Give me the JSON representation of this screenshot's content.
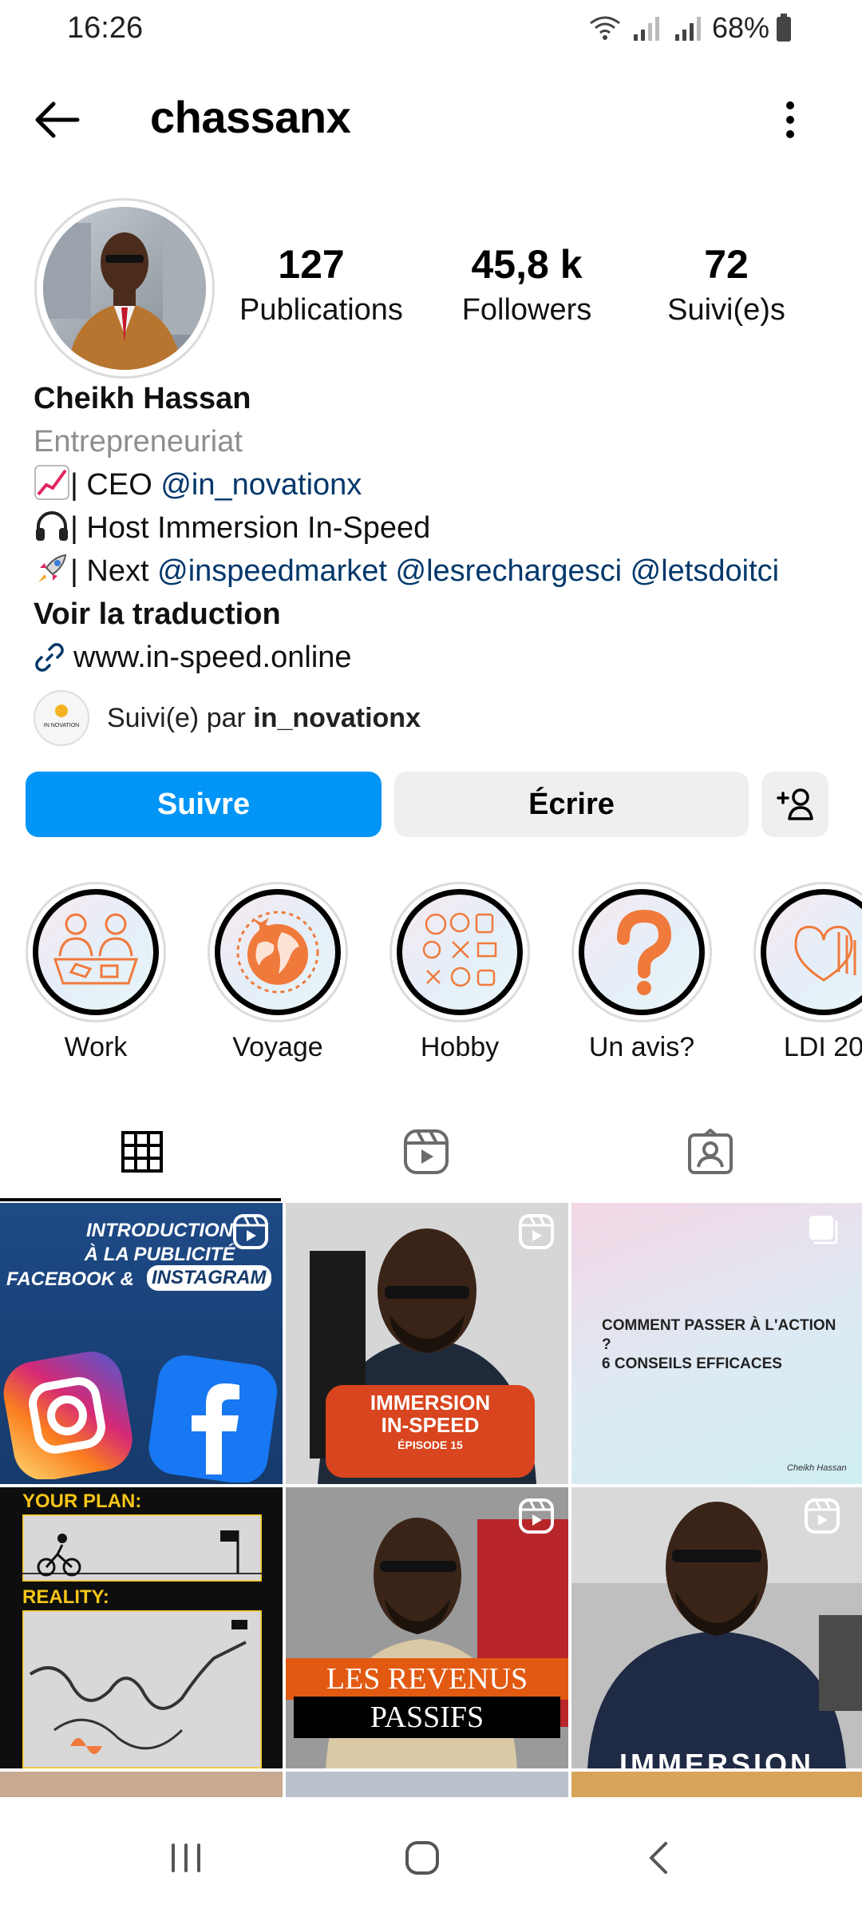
{
  "status_bar": {
    "time": "16:26",
    "battery": "68%"
  },
  "header": {
    "username": "chassanx"
  },
  "profile": {
    "stats": [
      {
        "value": "127",
        "label": "Publications"
      },
      {
        "value": "45,8 k",
        "label": "Followers"
      },
      {
        "value": "72",
        "label": "Suivi(e)s"
      }
    ],
    "name": "Cheikh Hassan",
    "category": "Entrepreneuriat",
    "bio": {
      "line1_text": "| CEO ",
      "line1_mention": "@in_novationx",
      "line2_text": "| Host Immersion In-Speed",
      "line3_text": "| Next ",
      "line3_mentions": [
        "@inspeedmarket",
        "@lesrechargesci",
        "@letsdoitci"
      ],
      "translate": "Voir la traduction",
      "link": "www.in-speed.online"
    },
    "followed_by": {
      "prefix": "Suivi(e) par ",
      "user": "in_novationx",
      "avatar_text": "IN NOVATION"
    }
  },
  "buttons": {
    "follow": "Suivre",
    "message": "Écrire"
  },
  "highlights": [
    {
      "label": "Work"
    },
    {
      "label": "Voyage"
    },
    {
      "label": "Hobby"
    },
    {
      "label": "Un avis?"
    },
    {
      "label": "LDI 20"
    }
  ],
  "posts": {
    "p1": {
      "line1": "INTRODUCTION",
      "line2": "À LA PUBLICITÉ",
      "line3": "FACEBOOK &",
      "line4": "INSTAGRAM"
    },
    "p2": {
      "line1": "IMMERSION",
      "line2": "IN-SPEED",
      "line3": "ÉPISODE 15"
    },
    "p3": {
      "line1": "COMMENT PASSER À L'ACTION ?",
      "line2": "6 CONSEILS EFFICACES",
      "signature": "Cheikh Hassan"
    },
    "p4": {
      "line1": "YOUR PLAN:",
      "line2": "REALITY:"
    },
    "p5": {
      "line1": "LES REVENUS",
      "line2": "PASSIFS"
    },
    "p6": {
      "line1": "IMMERSION"
    }
  },
  "colors": {
    "follow_button": "#0095f6",
    "link": "#00376b",
    "muted": "#8e8e8e",
    "highlight_art": "#f07a3c"
  }
}
